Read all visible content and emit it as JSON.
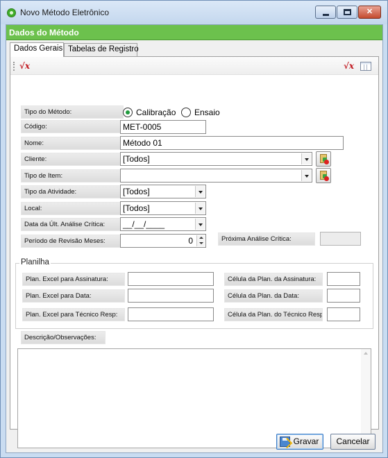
{
  "window": {
    "title": "Novo Método Eletrônico"
  },
  "header": {
    "title": "Dados do Método"
  },
  "tabs": [
    {
      "label": "Dados Gerais",
      "active": true
    },
    {
      "label": "Tabelas de Registro",
      "active": false
    }
  ],
  "toolbar": {
    "left_icon": "formula-icon",
    "right_icons": [
      "formula-icon",
      "grid-icon"
    ],
    "formula_glyph": "√x"
  },
  "form": {
    "tipo_metodo": {
      "label": "Tipo do Método:",
      "options": [
        {
          "label": "Calibração",
          "selected": true
        },
        {
          "label": "Ensaio",
          "selected": false
        }
      ]
    },
    "codigo": {
      "label": "Código:",
      "value": "MET-0005"
    },
    "nome": {
      "label": "Nome:",
      "value": "Método 01"
    },
    "cliente": {
      "label": "Cliente:",
      "value": "[Todos]"
    },
    "tipo_item": {
      "label": "Tipo de Item:",
      "value": ""
    },
    "tipo_atividade": {
      "label": "Tipo da Atividade:",
      "value": "[Todos]"
    },
    "local": {
      "label": "Local:",
      "value": "[Todos]"
    },
    "data_ult_analise": {
      "label": "Data da Últ. Análise Crítica:",
      "value": "__/__/____"
    },
    "periodo_revisao": {
      "label": "Período de Revisão Meses:",
      "value": "0"
    },
    "proxima_analise": {
      "label": "Próxima Análise Crítica:",
      "value": ""
    }
  },
  "planilha": {
    "title": "Planilha",
    "fields": [
      {
        "label": "Plan. Excel para Assinatura:",
        "value": ""
      },
      {
        "label": "Plan. Excel para Data:",
        "value": ""
      },
      {
        "label": "Plan. Excel para Técnico Resp:",
        "value": ""
      }
    ],
    "cells": [
      {
        "label": "Célula da Plan. da Assinatura:",
        "value": ""
      },
      {
        "label": "Célula da Plan. da Data:",
        "value": ""
      },
      {
        "label": "Célula da Plan. do Técnico Resp:",
        "value": ""
      }
    ]
  },
  "descricao": {
    "label": "Descrição/Observações:",
    "value": ""
  },
  "buttons": {
    "save": "Gravar",
    "cancel": "Cancelar"
  },
  "colors": {
    "header_green": "#6cc14d",
    "radio_selected": "#1e9a3c",
    "formula_red": "#c0141c"
  }
}
